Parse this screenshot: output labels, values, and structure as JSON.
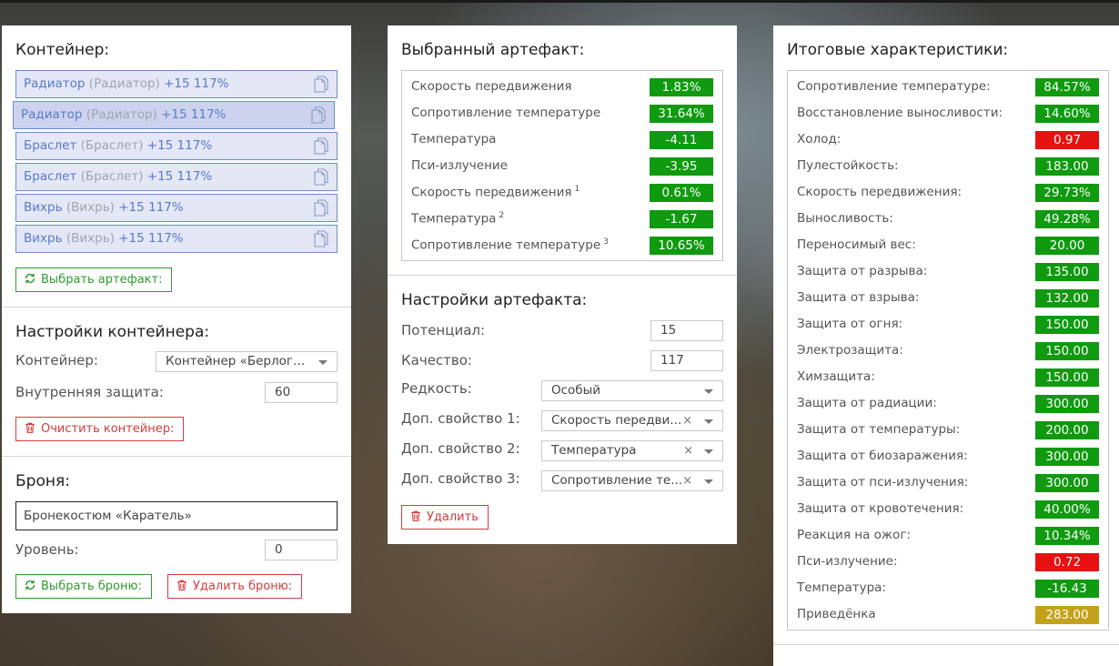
{
  "container_panel": {
    "title": "Контейнер:",
    "items": [
      {
        "name": "Радиатор",
        "paren": "(Радиатор)",
        "bonus": "+15 117%"
      },
      {
        "name": "Радиатор",
        "paren": "(Радиатор)",
        "bonus": "+15 117%"
      },
      {
        "name": "Браслет",
        "paren": "(Браслет)",
        "bonus": "+15 117%"
      },
      {
        "name": "Браслет",
        "paren": "(Браслет)",
        "bonus": "+15 117%"
      },
      {
        "name": "Вихрь",
        "paren": "(Вихрь)",
        "bonus": "+15 117%"
      },
      {
        "name": "Вихрь",
        "paren": "(Вихрь)",
        "bonus": "+15 117%"
      }
    ],
    "select_artifact_label": "Выбрать артефакт:"
  },
  "container_settings": {
    "title": "Настройки контейнера:",
    "container_label": "Контейнер:",
    "container_value": "Контейнер «Берлога...",
    "inner_protection_label": "Внутренняя защита:",
    "inner_protection_value": "60",
    "clear_label": "Очистить контейнер:"
  },
  "armor": {
    "title": "Броня:",
    "armor_value": "Бронекостюм «Каратель»",
    "level_label": "Уровень:",
    "level_value": "0",
    "select_label": "Выбрать броню:",
    "delete_label": "Удалить броню:"
  },
  "selected_artifact": {
    "title": "Выбранный артефакт:",
    "stats": [
      {
        "name": "Скорость передвижения",
        "sup": "",
        "value": "1.83%",
        "color": "green"
      },
      {
        "name": "Сопротивление температуре",
        "sup": "",
        "value": "31.64%",
        "color": "green"
      },
      {
        "name": "Температура",
        "sup": "",
        "value": "-4.11",
        "color": "green"
      },
      {
        "name": "Пси-излучение",
        "sup": "",
        "value": "-3.95",
        "color": "green"
      },
      {
        "name": "Скорость передвижения",
        "sup": "1",
        "value": "0.61%",
        "color": "green"
      },
      {
        "name": "Температура",
        "sup": "2",
        "value": "-1.67",
        "color": "green"
      },
      {
        "name": "Сопротивление температуре",
        "sup": "3",
        "value": "10.65%",
        "color": "green"
      }
    ]
  },
  "artifact_settings": {
    "title": "Настройки артефакта:",
    "potential_label": "Потенциал:",
    "potential_value": "15",
    "quality_label": "Качество:",
    "quality_value": "117",
    "rarity_label": "Редкость:",
    "rarity_value": "Особый",
    "prop1_label": "Доп. свойство 1:",
    "prop1_value": "Скорость передви...",
    "prop2_label": "Доп. свойство 2:",
    "prop2_value": "Температура",
    "prop3_label": "Доп. свойство 3:",
    "prop3_value": "Сопротивление те...",
    "clear_x": "×",
    "delete_label": "Удалить"
  },
  "totals": {
    "title": "Итоговые характеристики:",
    "stats": [
      {
        "name": "Сопротивление температуре:",
        "value": "84.57%",
        "color": "green"
      },
      {
        "name": "Восстановление выносливости:",
        "value": "14.60%",
        "color": "green"
      },
      {
        "name": "Холод:",
        "value": "0.97",
        "color": "red"
      },
      {
        "name": "Пулестойкость:",
        "value": "183.00",
        "color": "green"
      },
      {
        "name": "Скорость передвижения:",
        "value": "29.73%",
        "color": "green"
      },
      {
        "name": "Выносливость:",
        "value": "49.28%",
        "color": "green"
      },
      {
        "name": "Переносимый вес:",
        "value": "20.00",
        "color": "green"
      },
      {
        "name": "Защита от разрыва:",
        "value": "135.00",
        "color": "green"
      },
      {
        "name": "Защита от взрыва:",
        "value": "132.00",
        "color": "green"
      },
      {
        "name": "Защита от огня:",
        "value": "150.00",
        "color": "green"
      },
      {
        "name": "Электрозащита:",
        "value": "150.00",
        "color": "green"
      },
      {
        "name": "Химзащита:",
        "value": "150.00",
        "color": "green"
      },
      {
        "name": "Защита от радиации:",
        "value": "300.00",
        "color": "green"
      },
      {
        "name": "Защита от температуры:",
        "value": "200.00",
        "color": "green"
      },
      {
        "name": "Защита от биозаражения:",
        "value": "300.00",
        "color": "green"
      },
      {
        "name": "Защита от пси-излучения:",
        "value": "300.00",
        "color": "green"
      },
      {
        "name": "Защита от кровотечения:",
        "value": "40.00%",
        "color": "green"
      },
      {
        "name": "Реакция на ожог:",
        "value": "10.34%",
        "color": "green"
      },
      {
        "name": "Пси-излучение:",
        "value": "0.72",
        "color": "red"
      },
      {
        "name": "Температура:",
        "value": "-16.43",
        "color": "green"
      },
      {
        "name": "Приведёнка",
        "value": "283.00",
        "color": "yellow"
      }
    ]
  },
  "colors": {
    "green": "#0f9a0f",
    "red": "#e51212",
    "yellow": "#c3a21a",
    "accent_blue": "#5a7ac8"
  }
}
